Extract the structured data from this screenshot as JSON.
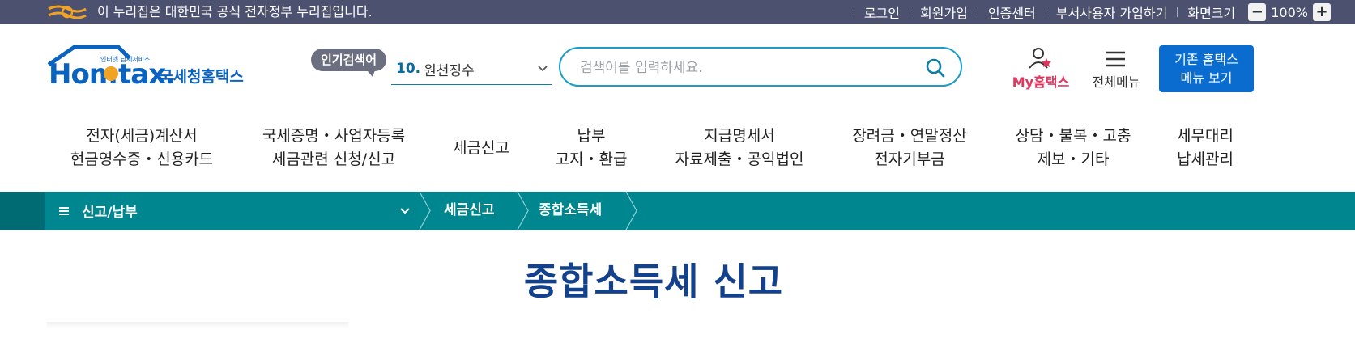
{
  "gov_bar": {
    "notice": "이 누리집은 대한민국 공식 전자정부 누리집입니다.",
    "links": [
      "로그인",
      "회원가입",
      "인증센터",
      "부서사용자 가입하기",
      "화면크기"
    ],
    "zoom_minus": "−",
    "zoom_level": "100%",
    "zoom_plus": "+"
  },
  "logo": {
    "small_text": "인터넷 납세서비스",
    "main_part1": "Hom",
    "main_part2": "tax.",
    "korean_name": "국세청홈택스"
  },
  "header": {
    "popular_label": "인기검색어",
    "popular_rank": "10.",
    "popular_keyword": "원천징수",
    "search_placeholder": "검색어를 입력하세요.",
    "my_hometax": "My홈택스",
    "all_menu": "전체메뉴",
    "legacy_line1": "기존 홈택스",
    "legacy_line2": "메뉴 보기"
  },
  "gnb": [
    {
      "line1": "전자(세금)계산서",
      "line2": "현금영수증・신용카드"
    },
    {
      "line1": "국세증명・사업자등록",
      "line2": "세금관련 신청/신고"
    },
    {
      "line1": "세금신고",
      "line2": ""
    },
    {
      "line1": "납부",
      "line2": "고지・환급"
    },
    {
      "line1": "지급명세서",
      "line2": "자료제출・공익법인"
    },
    {
      "line1": "장려금・연말정산",
      "line2": "전자기부금"
    },
    {
      "line1": "상담・불복・고충",
      "line2": "제보・기타"
    },
    {
      "line1": "세무대리",
      "line2": "납세관리"
    }
  ],
  "breadcrumb": {
    "menu": "신고/납부",
    "level2": "세금신고",
    "level3": "종합소득세"
  },
  "page": {
    "title": "종합소득세 신고"
  },
  "colors": {
    "gov_bar": "#4c5170",
    "teal": "#00868f",
    "brand_blue": "#0a6ccf",
    "title_blue": "#14418b",
    "my_pink": "#e2365f"
  }
}
